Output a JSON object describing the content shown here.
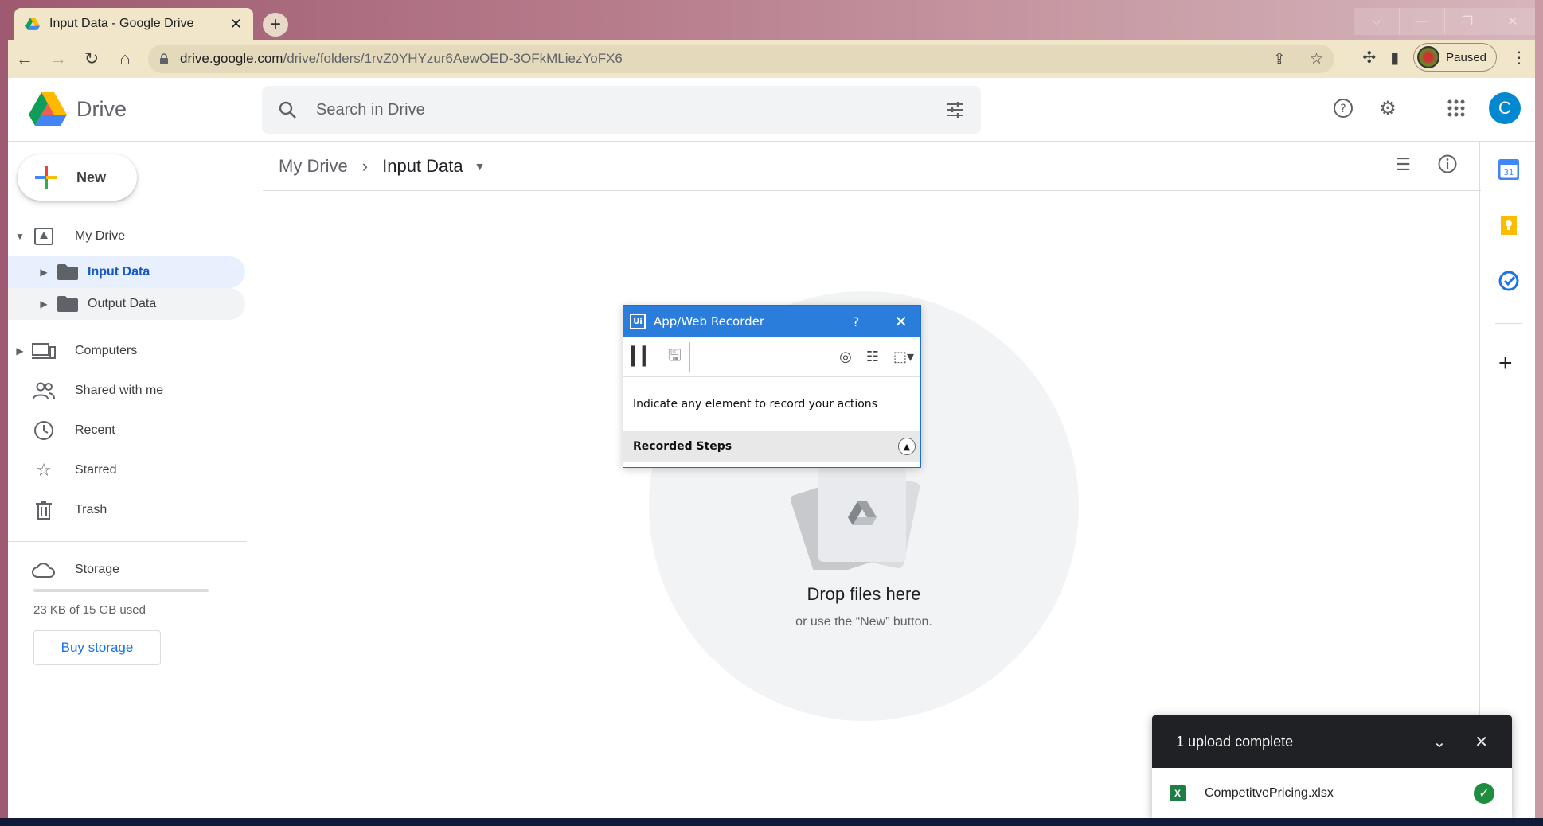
{
  "browser": {
    "tab_title": "Input Data - Google Drive",
    "tab_close": "✕",
    "new_tab": "+",
    "url_host": "drive.google.com",
    "url_path": "/drive/folders/1rvZ0YHYzur6AewOED-3OFkMLiezYoFX6",
    "profile_status": "Paused",
    "window_buttons": [
      "⌵",
      "—",
      "❐",
      "✕"
    ]
  },
  "header": {
    "app_name": "Drive",
    "search_placeholder": "Search in Drive",
    "avatar_letter": "C"
  },
  "sidebar": {
    "new_label": "New",
    "my_drive": "My Drive",
    "folders": [
      {
        "label": "Input Data",
        "active": true
      },
      {
        "label": "Output Data",
        "active": false
      }
    ],
    "items": [
      {
        "label": "Computers",
        "icon": "computers-icon"
      },
      {
        "label": "Shared with me",
        "icon": "shared-icon"
      },
      {
        "label": "Recent",
        "icon": "clock-icon"
      },
      {
        "label": "Starred",
        "icon": "star-icon"
      },
      {
        "label": "Trash",
        "icon": "trash-icon"
      }
    ],
    "storage_label": "Storage",
    "storage_used": "23 KB of 15 GB used",
    "buy_storage": "Buy storage"
  },
  "main": {
    "breadcrumb_root": "My Drive",
    "breadcrumb_current": "Input Data",
    "drop_title": "Drop files here",
    "drop_subtitle": "or use the “New” button."
  },
  "recorder": {
    "logo": "Ui",
    "title": "App/Web Recorder",
    "help": "?",
    "close": "✕",
    "message": "Indicate any element to record your actions",
    "steps_label": "Recorded Steps"
  },
  "upload_toast": {
    "title": "1 upload complete",
    "file_name": "CompetitvePricing.xlsx",
    "file_badge": "X"
  },
  "colors": {
    "accent": "#1a73e8",
    "active_folder_bg": "#e8f0fe",
    "recorder_title": "#2a7ddb",
    "toast_header": "#202124",
    "success": "#1e8e3e"
  }
}
